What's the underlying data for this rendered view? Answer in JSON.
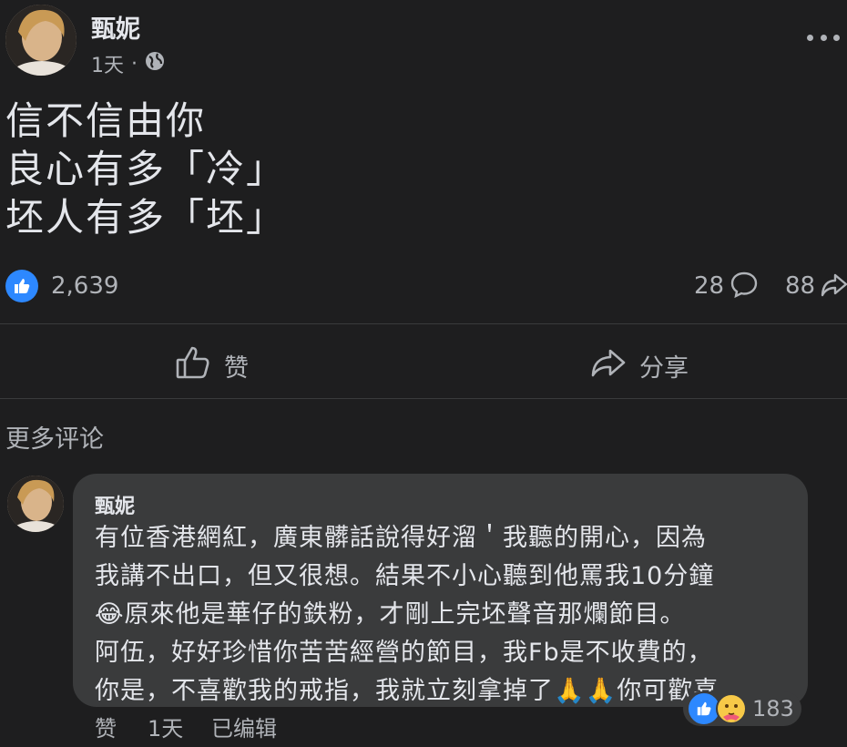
{
  "post": {
    "author": "甄妮",
    "time": "1天",
    "separator": "·",
    "lines": [
      "信不信由你",
      "良心有多「冷」",
      "坯人有多「坯」"
    ],
    "reactions_count": "2,639",
    "comments_count": "28",
    "shares_count": "88"
  },
  "actions": {
    "like_label": "赞",
    "share_label": "分享"
  },
  "more_comments_label": "更多评论",
  "comment": {
    "author": "甄妮",
    "lines": [
      "有位香港網紅，廣東髒話說得好溜＇我聽的開心，因為",
      "我講不出口，但又很想。結果不小心聽到他罵我10分鐘",
      "😂原來他是華仔的鉄粉，才剛上完坯聲音那爛節目。",
      "阿伍，好好珍惜你苦苦經營的節目，我Fb是不收費的，",
      "你是，不喜歡我的戒指，我就立刻拿掉了🙏🙏你可歡喜"
    ],
    "like_label": "赞",
    "time": "1天",
    "edited_label": "已编辑",
    "reactions_count": "183"
  },
  "colors": {
    "background": "#1e1e1f",
    "bubble": "#3a3b3c",
    "text_primary": "#e4e6eb",
    "text_secondary": "#b0b3b8",
    "like_blue": "#2d88ff"
  },
  "icons": [
    "more-icon",
    "globe-icon",
    "like-icon",
    "comment-icon",
    "share-icon",
    "thumbs-up-icon",
    "share-arrow-icon",
    "care-emoji-icon"
  ]
}
